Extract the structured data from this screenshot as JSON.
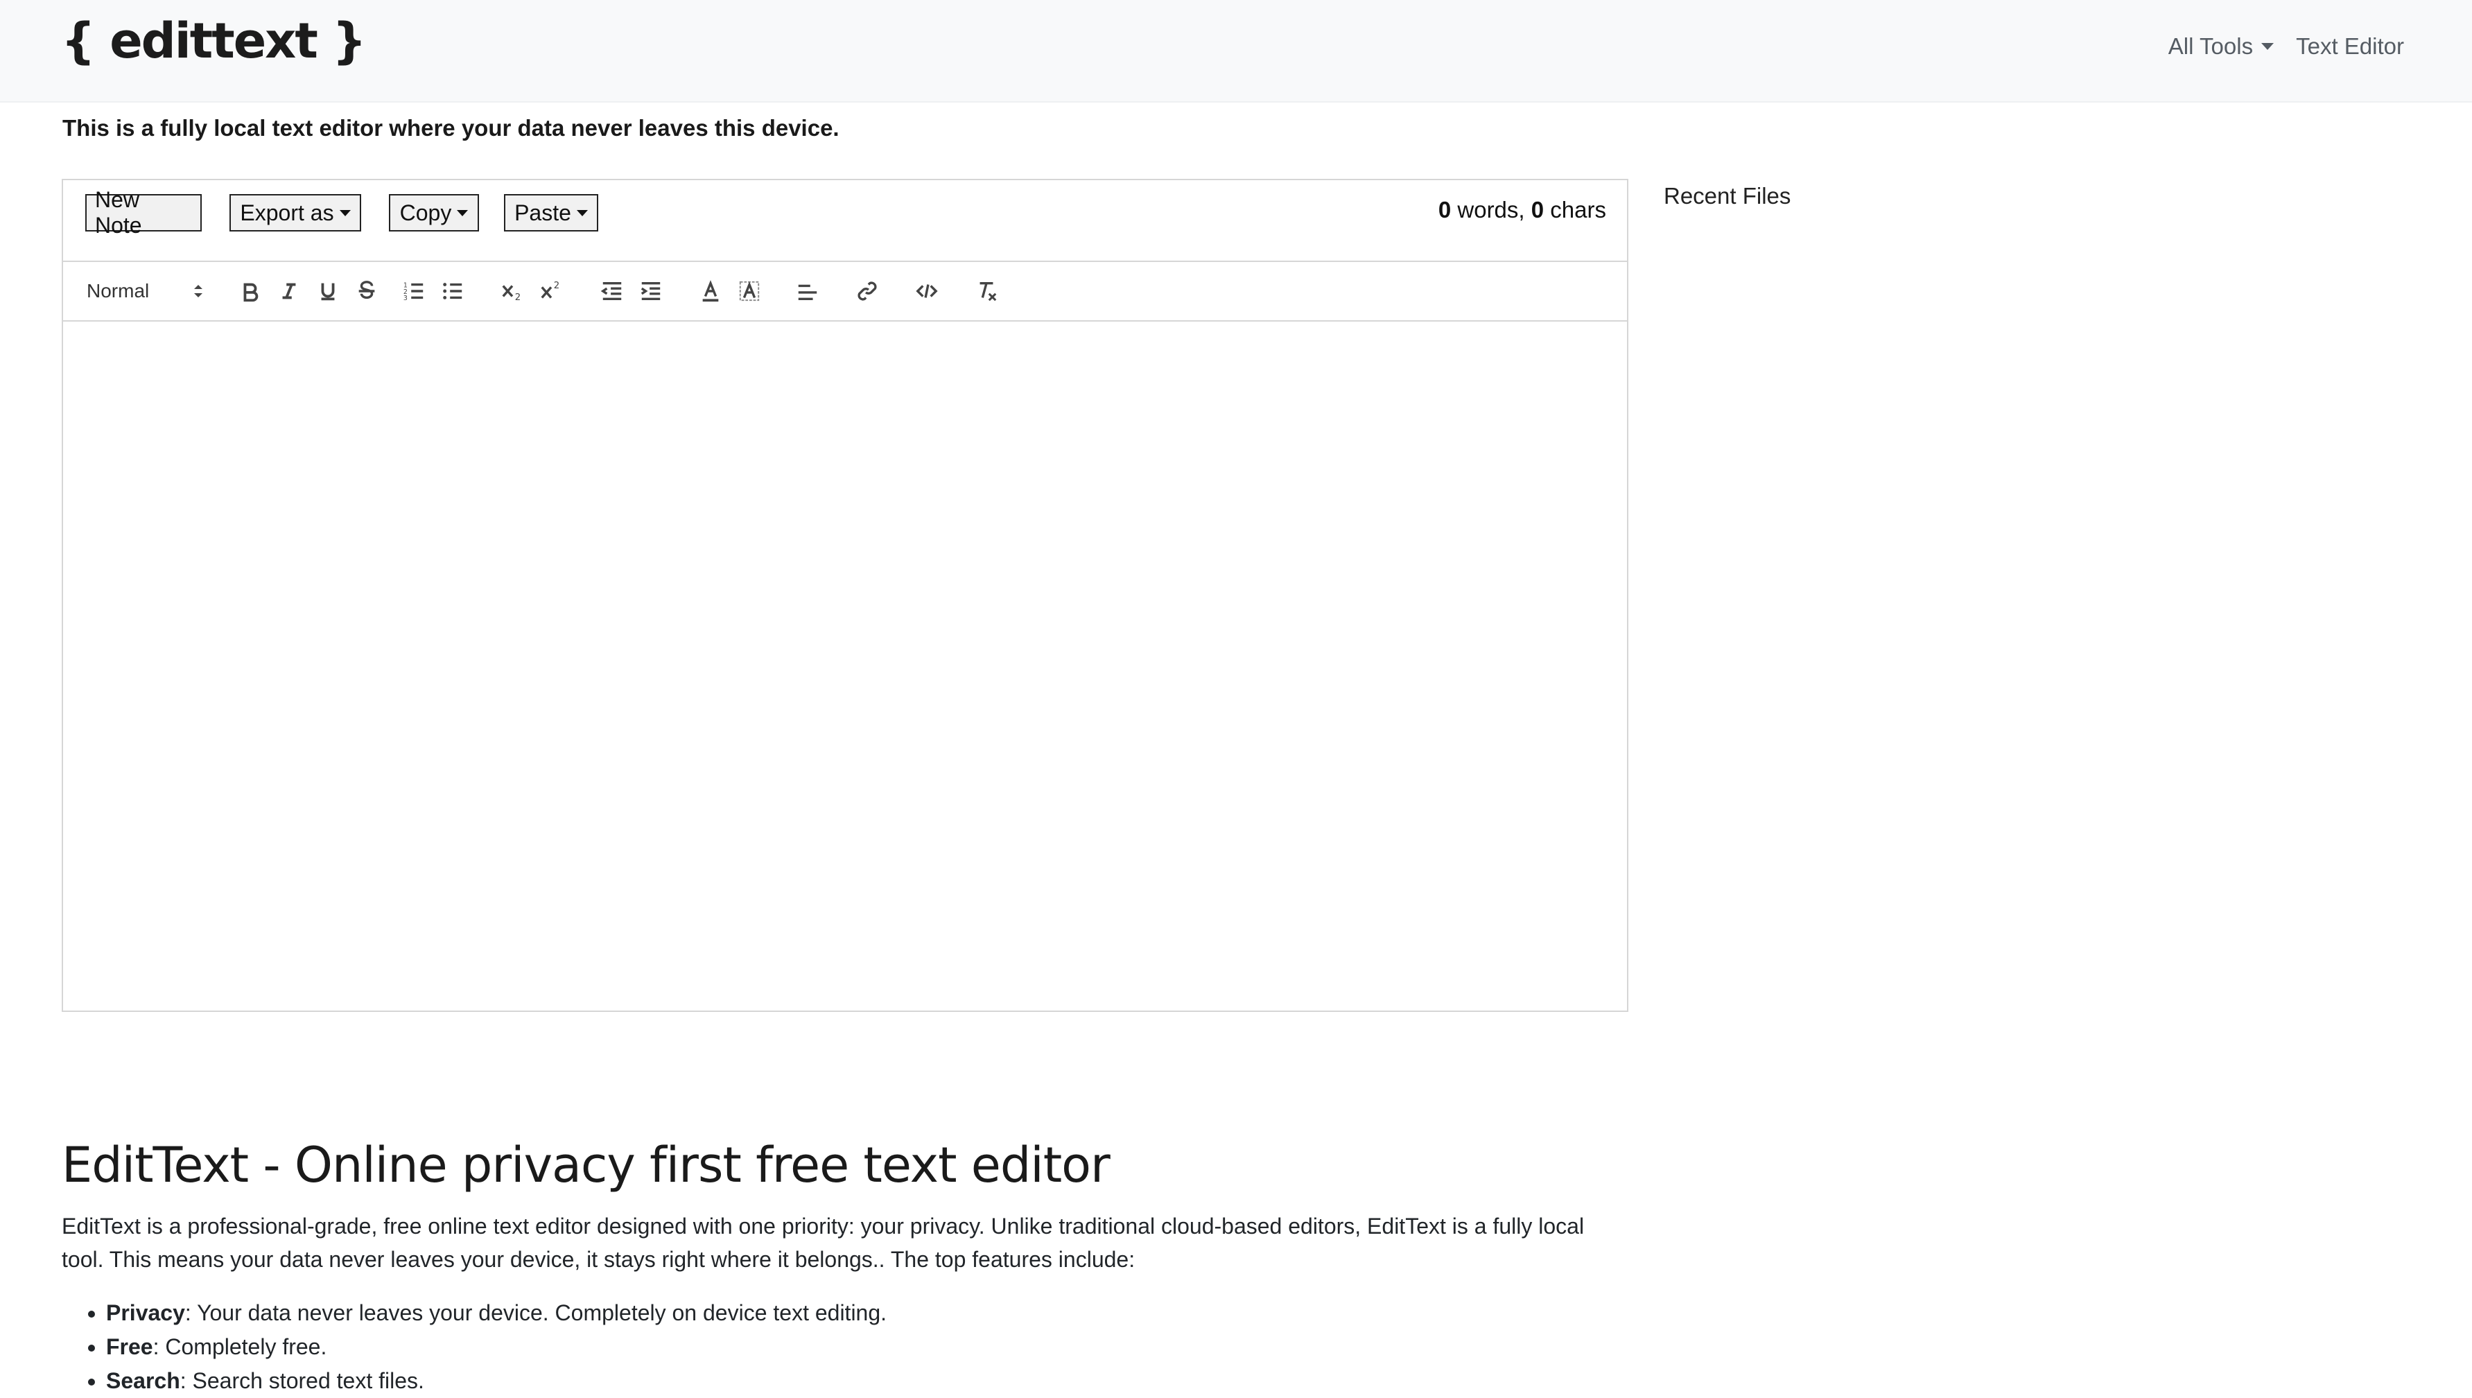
{
  "nav": {
    "brand": "{ edittext }",
    "all_tools": "All Tools",
    "text_editor": "Text Editor"
  },
  "tagline": "This is a fully local text editor where your data never leaves this device.",
  "editor": {
    "buttons": {
      "new_note": "New Note",
      "export_as": "Export as",
      "copy": "Copy",
      "paste": "Paste"
    },
    "counter": {
      "words": "0",
      "words_label": " words, ",
      "chars": "0",
      "chars_label": " chars"
    },
    "toolbar": {
      "heading_select": "Normal",
      "icons": [
        "bold-icon",
        "italic-icon",
        "underline-icon",
        "strikethrough-icon",
        "ordered-list-icon",
        "bullet-list-icon",
        "subscript-icon",
        "superscript-icon",
        "outdent-icon",
        "indent-icon",
        "text-color-icon",
        "background-color-icon",
        "align-icon",
        "link-icon",
        "code-icon",
        "clear-format-icon"
      ]
    },
    "body_text": ""
  },
  "sidebar": {
    "recent_files": "Recent Files"
  },
  "content": {
    "title": "EditText - Online privacy first free text editor",
    "intro": "EditText is a professional-grade, free online text editor designed with one priority: your privacy. Unlike traditional cloud-based editors, EditText is a fully local tool. This means your data never leaves your device, it stays right where it belongs.. The top features include:",
    "features": [
      {
        "term": "Privacy",
        "desc": ": Your data never leaves your device. Completely on device text editing."
      },
      {
        "term": "Free",
        "desc": ": Completely free."
      },
      {
        "term": "Search",
        "desc": ": Search stored text files."
      }
    ]
  },
  "colors": {
    "navbar_bg": "#f8f9fa",
    "border": "#d6d6d6",
    "text": "#212529"
  }
}
